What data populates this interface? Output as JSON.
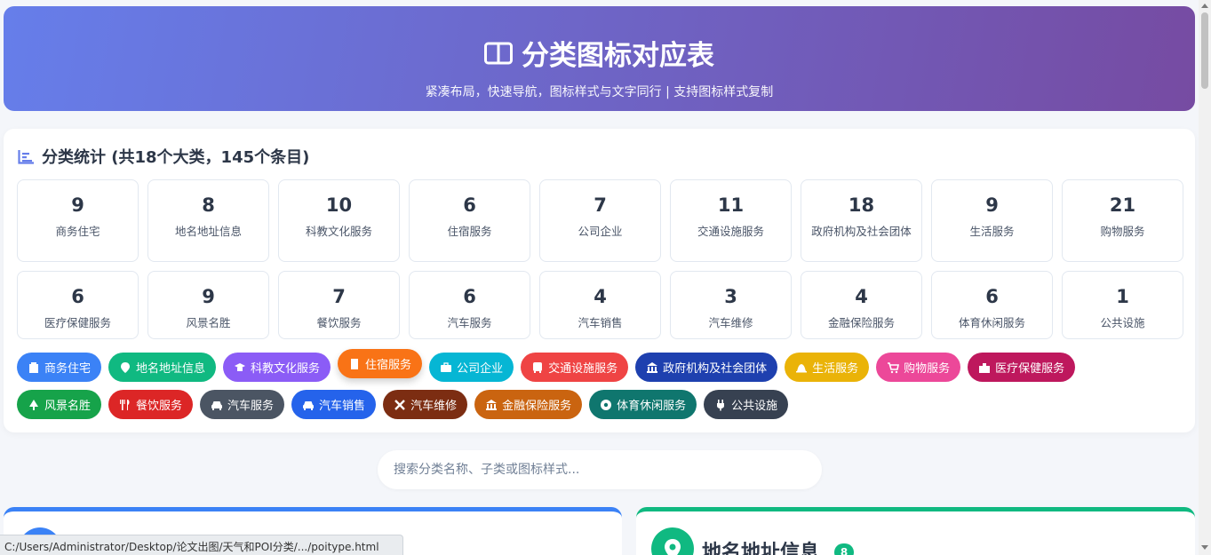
{
  "header": {
    "title": "分类图标对应表",
    "subtitle": "紧凑布局，快速导航，图标样式与文字同行 | 支持图标样式复制"
  },
  "stats": {
    "title": "分类统计 (共18个大类，145个条目)",
    "row1": [
      {
        "count": "9",
        "label": "商务住宅"
      },
      {
        "count": "8",
        "label": "地名地址信息"
      },
      {
        "count": "10",
        "label": "科教文化服务"
      },
      {
        "count": "6",
        "label": "住宿服务"
      },
      {
        "count": "7",
        "label": "公司企业"
      },
      {
        "count": "11",
        "label": "交通设施服务"
      },
      {
        "count": "18",
        "label": "政府机构及社会团体"
      },
      {
        "count": "9",
        "label": "生活服务"
      },
      {
        "count": "21",
        "label": "购物服务"
      }
    ],
    "row2": [
      {
        "count": "6",
        "label": "医疗保健服务"
      },
      {
        "count": "9",
        "label": "风景名胜"
      },
      {
        "count": "7",
        "label": "餐饮服务"
      },
      {
        "count": "6",
        "label": "汽车服务"
      },
      {
        "count": "4",
        "label": "汽车销售"
      },
      {
        "count": "3",
        "label": "汽车维修"
      },
      {
        "count": "4",
        "label": "金融保险服务"
      },
      {
        "count": "6",
        "label": "体育休闲服务"
      },
      {
        "count": "1",
        "label": "公共设施"
      }
    ]
  },
  "pills": {
    "row1": [
      {
        "label": "商务住宅",
        "color": "#3b82f6",
        "icon": "building-icon"
      },
      {
        "label": "地名地址信息",
        "color": "#10b981",
        "icon": "map-pin-icon"
      },
      {
        "label": "科教文化服务",
        "color": "#8b5cf6",
        "icon": "graduation-cap-icon"
      },
      {
        "label": "住宿服务",
        "color": "#f97316",
        "icon": "hotel-icon"
      },
      {
        "label": "公司企业",
        "color": "#06b6d4",
        "icon": "briefcase-icon"
      },
      {
        "label": "交通设施服务",
        "color": "#ef4444",
        "icon": "bus-icon"
      },
      {
        "label": "政府机构及社会团体",
        "color": "#1e40af",
        "icon": "landmark-icon"
      },
      {
        "label": "生活服务",
        "color": "#eab308",
        "icon": "bell-icon"
      },
      {
        "label": "购物服务",
        "color": "#ec4899",
        "icon": "cart-icon"
      },
      {
        "label": "医疗保健服务",
        "color": "#be185d",
        "icon": "hospital-icon"
      }
    ],
    "row2": [
      {
        "label": "风景名胜",
        "color": "#16a34a",
        "icon": "tree-icon"
      },
      {
        "label": "餐饮服务",
        "color": "#dc2626",
        "icon": "utensils-icon"
      },
      {
        "label": "汽车服务",
        "color": "#4b5563",
        "icon": "car-icon"
      },
      {
        "label": "汽车销售",
        "color": "#2563eb",
        "icon": "car-icon"
      },
      {
        "label": "汽车维修",
        "color": "#7c2d12",
        "icon": "tools-icon"
      },
      {
        "label": "金融保险服务",
        "color": "#ca6410",
        "icon": "bank-icon"
      },
      {
        "label": "体育休闲服务",
        "color": "#0f766e",
        "icon": "ball-icon"
      },
      {
        "label": "公共设施",
        "color": "#374151",
        "icon": "plug-icon"
      }
    ]
  },
  "search": {
    "placeholder": "搜索分类名称、子类或图标样式..."
  },
  "categories": {
    "right": {
      "name": "地名地址信息",
      "count": "8"
    }
  },
  "statusbar": {
    "url": "C:/Users/Administrator/Desktop/论文出图/天气和POI分类/.../poitype.html"
  },
  "colors": {
    "header_start": "#667eea",
    "header_end": "#764ba2",
    "accent_blue": "#3b82f6",
    "accent_green": "#10b981"
  }
}
